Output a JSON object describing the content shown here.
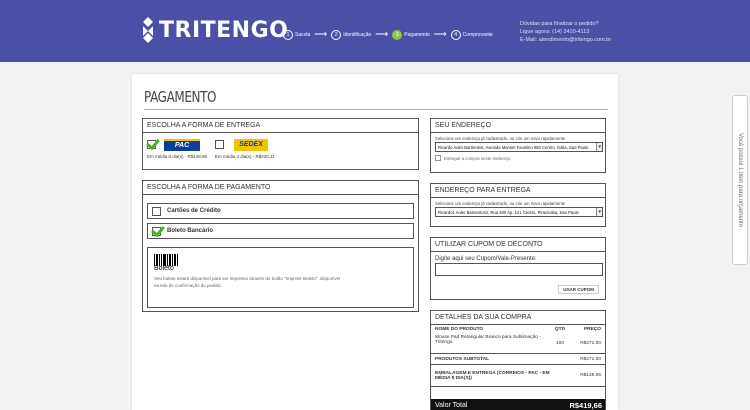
{
  "header": {
    "logo_text": "TRITENGO",
    "steps": [
      {
        "num": "1",
        "label": "Sacola"
      },
      {
        "num": "2",
        "label": "Identificação"
      },
      {
        "num": "3",
        "label": "Pagamento"
      },
      {
        "num": "4",
        "label": "Comprovante"
      }
    ],
    "active_step": 3,
    "contact": {
      "line1": "Dúvidas para finalizar o pedido?",
      "line2": "Ligue agora: (14) 3410-4113",
      "line3": "E-Mail: atendimento@tritengo.com.br"
    },
    "colors": {
      "bar": "#4b4fa6",
      "active_step": "#8dc63f"
    }
  },
  "side_tab": {
    "label": "Você possui 1 item para orçamento"
  },
  "page": {
    "title": "PAGAMENTO"
  },
  "shipping": {
    "title": "ESCOLHA A FORMA DE ENTREGA",
    "options": [
      {
        "logo_text": "PAC",
        "desc": "Em média 8 dia(s) - R$148,66",
        "checked": true
      },
      {
        "logo_text": "SEDEX",
        "desc": "Em média 4 dia(s) - R$220,11",
        "checked": false
      }
    ]
  },
  "payment": {
    "title": "ESCOLHA A FORMA DE PAGAMENTO",
    "options": [
      {
        "label": "Cartões de Crédito",
        "checked": false
      },
      {
        "label": "Boleto Bancário",
        "checked": true
      }
    ],
    "boleto_label": "Boleto",
    "boleto_text": "Seu boleto estará disponível para ser impresso através do botão \"Imprimir Boleto\", disponível na tela de confirmação do pedido."
  },
  "address": {
    "title": "SEU ENDEREÇO",
    "select_label": "Selecione um endereço já cadastrado, ou crie um novo rapidamente",
    "selected": "Ricardo Auler Barrientos, Avenida Manoel Faustino 950 Centro, Gália, Sao Paulo",
    "deliver_here": "Entregar a compra neste endereço"
  },
  "delivery": {
    "title": "ENDEREÇO PARA ENTREGA",
    "select_label": "Selecione um endereço já cadastrado, ou crie um novo rapidamente",
    "selected": "Ricardo1 Auler Barrientos2, Rua 490 Ap. 121 Centro, Piracicaba, Sao Paulo"
  },
  "coupon": {
    "title": "UTILIZAR CUPOM DE DECONTO",
    "label": "Digite aqui seu Cupom/Vale-Presente:",
    "input_value": "",
    "button": "USAR CUPOM"
  },
  "details": {
    "title": "DETALHES DA SUA COMPRA",
    "col_product": "NOME DO PRODUTO",
    "col_qty": "QTD",
    "col_price": "PREÇO",
    "item_name": "Mouse Pad Retangular Branco para Sublimação - Tritengo",
    "item_qty": "100",
    "item_price": "R$271,00",
    "subtotal_label": "PRODUTOS SUBTOTAL",
    "subtotal_value": "R$271,00",
    "shipping_label": "EMBALAGEM E ENTREGA (CORREIOS - PAC - EM MÉDIA 8 DIA(S))",
    "shipping_value": "R$148,66",
    "total_label": "Valor Total",
    "total_value": "R$419,66"
  }
}
